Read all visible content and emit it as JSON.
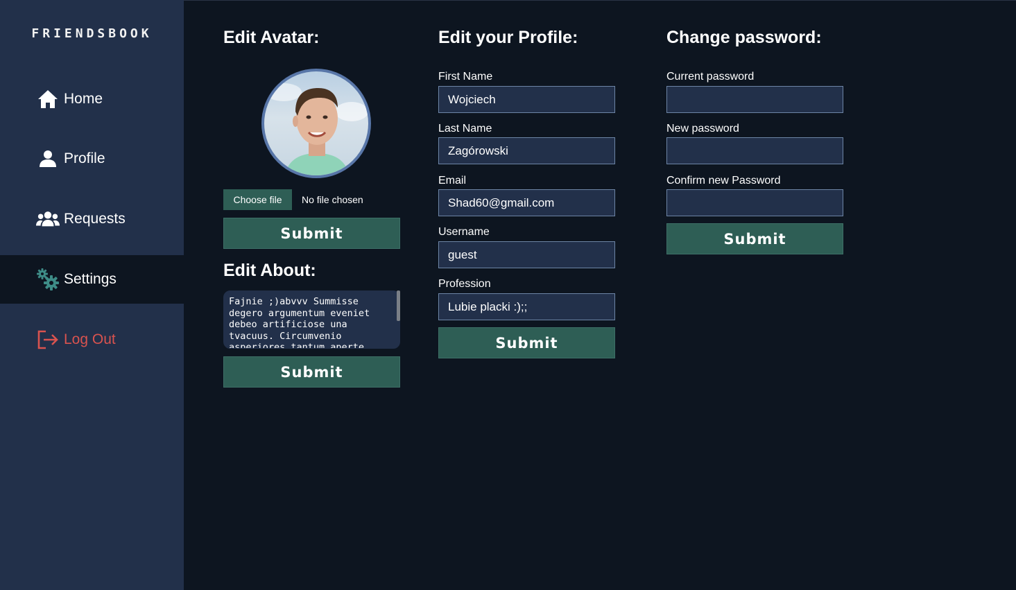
{
  "sidebar": {
    "logo": "FRIENDSBOOK",
    "items": [
      {
        "label": "Home",
        "icon": "home-icon"
      },
      {
        "label": "Profile",
        "icon": "user-icon"
      },
      {
        "label": "Requests",
        "icon": "users-icon"
      },
      {
        "label": "Settings",
        "icon": "gears-icon",
        "active": true
      },
      {
        "label": "Log Out",
        "icon": "logout-icon"
      }
    ]
  },
  "avatar_section": {
    "title": "Edit Avatar:",
    "choose_file_label": "Choose file",
    "no_file_text": "No file chosen",
    "submit_label": "Submit"
  },
  "about_section": {
    "title": "Edit About:",
    "about_text": "Fajnie ;)abvvv Summisse degero argumentum eveniet debeo artificiose una tvacuus. Circumvenio asperiores tantum aperte",
    "submit_label": "Submit"
  },
  "profile_section": {
    "title": "Edit your Profile:",
    "fields": [
      {
        "label": "First Name",
        "value": "Wojciech"
      },
      {
        "label": "Last Name",
        "value": "Zagórowski"
      },
      {
        "label": "Email",
        "value": "Shad60@gmail.com"
      },
      {
        "label": "Username",
        "value": "guest"
      },
      {
        "label": "Profession",
        "value": "Lubie placki :);;"
      }
    ],
    "submit_label": "Submit"
  },
  "password_section": {
    "title": "Change password:",
    "fields": [
      {
        "label": "Current password",
        "value": ""
      },
      {
        "label": "New password",
        "value": ""
      },
      {
        "label": "Confirm new Password",
        "value": ""
      }
    ],
    "submit_label": "Submit"
  },
  "colors": {
    "sidebar_bg": "#22304a",
    "page_bg": "#0d1520",
    "accent_button": "#2e5e55",
    "logout_red": "#d9534f"
  }
}
